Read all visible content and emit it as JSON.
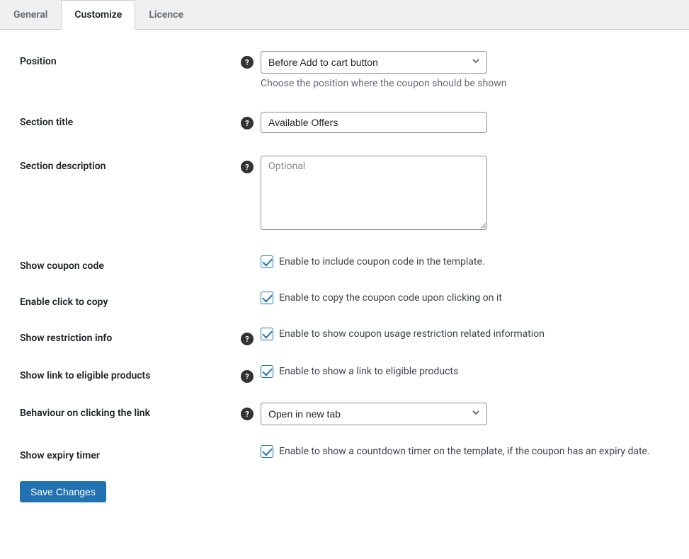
{
  "tabs": [
    {
      "label": "General",
      "active": false
    },
    {
      "label": "Customize",
      "active": true
    },
    {
      "label": "Licence",
      "active": false
    }
  ],
  "fields": {
    "position": {
      "label": "Position",
      "selected": "Before Add to cart button",
      "desc": "Choose the position where the coupon should be shown"
    },
    "section_title": {
      "label": "Section title",
      "value": "Available Offers"
    },
    "section_description": {
      "label": "Section description",
      "placeholder": "Optional",
      "value": ""
    },
    "show_coupon_code": {
      "label": "Show coupon code",
      "cb_label": "Enable to include coupon code in the template."
    },
    "enable_click_copy": {
      "label": "Enable click to copy",
      "cb_label": "Enable to copy the coupon code upon clicking on it"
    },
    "show_restriction_info": {
      "label": "Show restriction info",
      "cb_label": "Enable to show coupon usage restriction related information"
    },
    "show_link_eligible": {
      "label": "Show link to eligible products",
      "cb_label": "Enable to show a link to eligible products"
    },
    "behaviour_link": {
      "label": "Behaviour on clicking the link",
      "selected": "Open in new tab"
    },
    "show_expiry_timer": {
      "label": "Show expiry timer",
      "cb_label": "Enable to show a countdown timer on the template, if the coupon has an expiry date."
    }
  },
  "save_label": "Save Changes"
}
